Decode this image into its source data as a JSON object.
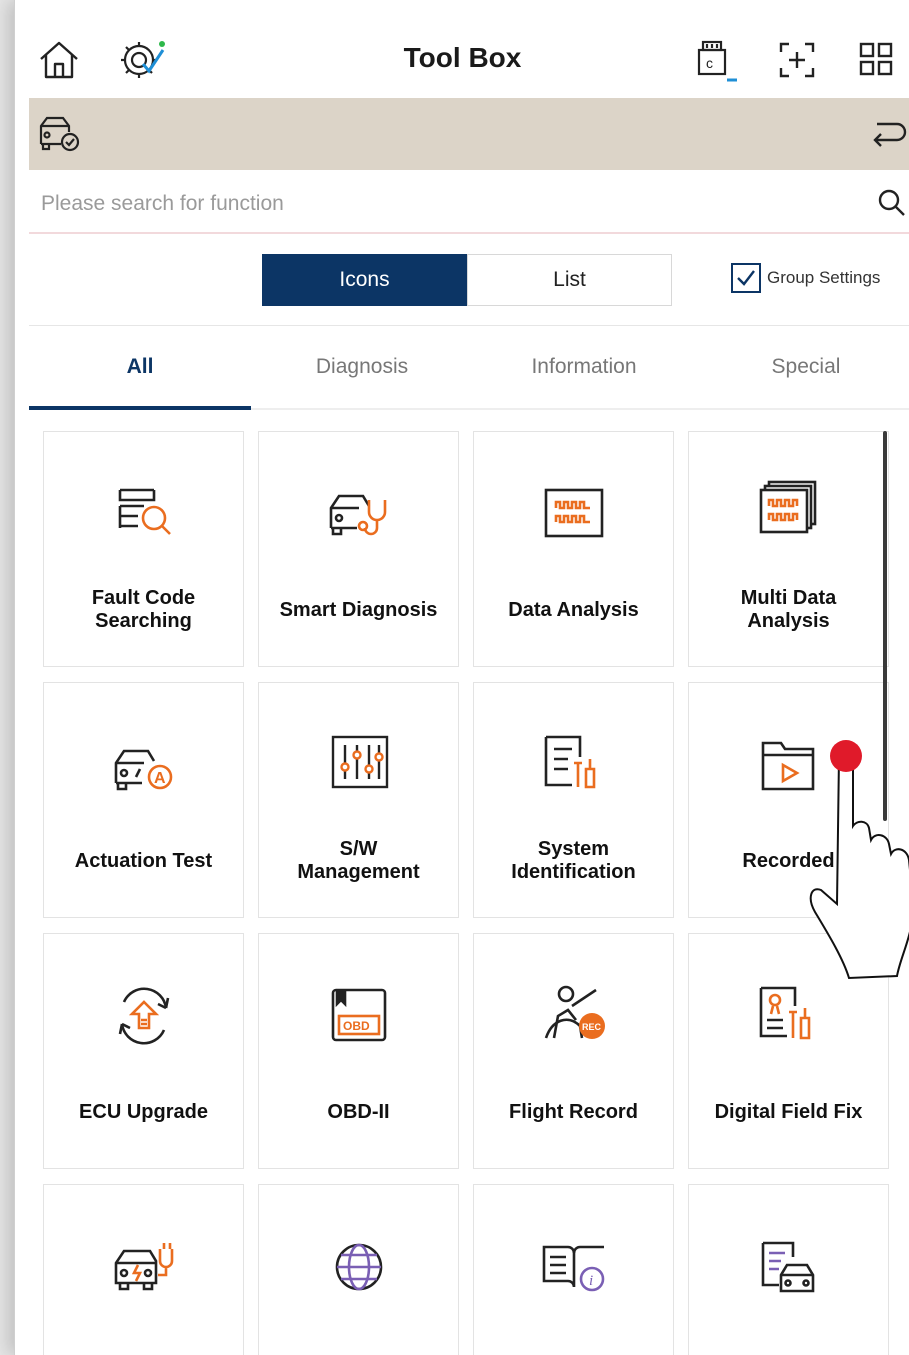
{
  "header": {
    "title": "Tool Box",
    "icons": [
      "home-icon",
      "vehicle-settings-icon",
      "vci-connection-icon",
      "capture-icon",
      "apps-grid-icon"
    ]
  },
  "vehicle_bar": {
    "icons": [
      "vehicle-info-icon",
      "return-icon"
    ]
  },
  "search": {
    "placeholder": "Please search for function"
  },
  "view_toggle": {
    "icons_label": "Icons",
    "list_label": "List",
    "selected": "Icons"
  },
  "group_settings": {
    "label": "Group Settings",
    "checked": true
  },
  "tabs": [
    {
      "label": "All",
      "active": true
    },
    {
      "label": "Diagnosis",
      "active": false
    },
    {
      "label": "Information",
      "active": false
    },
    {
      "label": "Special",
      "active": false
    }
  ],
  "tiles": [
    {
      "label": "Fault Code\nSearching",
      "icon": "fault-code-search-icon"
    },
    {
      "label": "Smart Diagnosis",
      "icon": "smart-diagnosis-icon"
    },
    {
      "label": "Data Analysis",
      "icon": "data-analysis-icon"
    },
    {
      "label": "Multi Data\nAnalysis",
      "icon": "multi-data-analysis-icon"
    },
    {
      "label": "Actuation Test",
      "icon": "actuation-test-icon"
    },
    {
      "label": "S/W\nManagement",
      "icon": "sw-management-icon"
    },
    {
      "label": "System\nIdentification",
      "icon": "system-identification-icon"
    },
    {
      "label": "Recorded",
      "icon": "recorded-folder-icon"
    },
    {
      "label": "ECU Upgrade",
      "icon": "ecu-upgrade-icon"
    },
    {
      "label": "OBD-II",
      "icon": "obd-icon"
    },
    {
      "label": "Flight Record",
      "icon": "flight-record-icon"
    },
    {
      "label": "Digital Field Fix",
      "icon": "digital-field-fix-icon"
    },
    {
      "label": "",
      "icon": "ev-charging-icon"
    },
    {
      "label": "",
      "icon": "globe-icon"
    },
    {
      "label": "",
      "icon": "manual-info-icon"
    },
    {
      "label": "",
      "icon": "vehicle-document-icon"
    }
  ],
  "colors": {
    "accent": "#0c3565",
    "icon_orange": "#ea6d1f",
    "vehicle_bar": "#dcd4c8",
    "tap_indicator": "#e01a2a",
    "icon_purple": "#7a5fb4"
  },
  "overlay": {
    "icon": "pointing-hand-icon"
  }
}
